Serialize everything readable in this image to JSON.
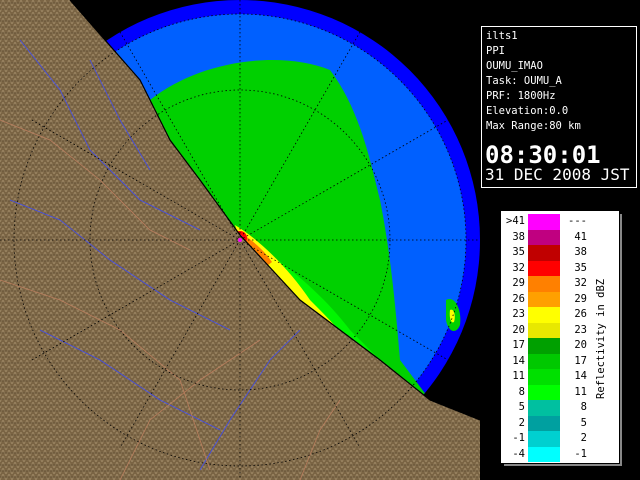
{
  "info": {
    "radar": "ilts1",
    "scan_type": "PPI",
    "site": "OUMU_IMAO",
    "task": "Task: OUMU_A",
    "prf": "PRF: 1800Hz",
    "elevation": "Elevation:0.0",
    "max_range": "Max Range:80 km",
    "time": "08:30:01",
    "date": "31 DEC 2008 JST"
  },
  "legend": {
    "title": "Reflectivity in dBZ",
    "rows": [
      {
        "low": ">41",
        "high": "---",
        "color": "#ff00ff"
      },
      {
        "low": "38",
        "high": "41",
        "color": "#c00080"
      },
      {
        "low": "35",
        "high": "38",
        "color": "#c00000"
      },
      {
        "low": "32",
        "high": "35",
        "color": "#ff0000"
      },
      {
        "low": "29",
        "high": "32",
        "color": "#ff8000"
      },
      {
        "low": "26",
        "high": "29",
        "color": "#ffa000"
      },
      {
        "low": "23",
        "high": "26",
        "color": "#ffff00"
      },
      {
        "low": "20",
        "high": "23",
        "color": "#e8e800"
      },
      {
        "low": "17",
        "high": "20",
        "color": "#00a000"
      },
      {
        "low": "14",
        "high": "17",
        "color": "#00c800"
      },
      {
        "low": "11",
        "high": "14",
        "color": "#00e000"
      },
      {
        "low": "8",
        "high": "11",
        "color": "#00ff00"
      },
      {
        "low": "5",
        "high": "8",
        "color": "#00c0a0"
      },
      {
        "low": "2",
        "high": "5",
        "color": "#00a0a0"
      },
      {
        "low": "-1",
        "high": "2",
        "color": "#00d0d0"
      },
      {
        "low": "-4",
        "high": "-1",
        "color": "#00ffff"
      }
    ]
  },
  "map": {
    "colors": {
      "sea_outer": "#0000ff",
      "sea_inner": "#0060ff",
      "land": "#7a6444",
      "echo_light": "#00d000",
      "echo_core": "#ffff00",
      "echo_strong": "#ff0000"
    }
  }
}
